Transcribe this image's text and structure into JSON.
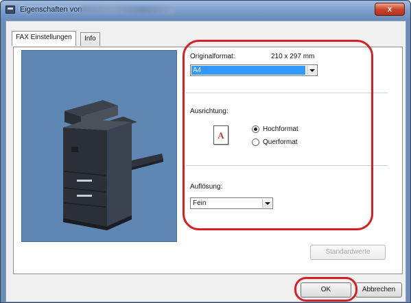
{
  "window": {
    "title": "Eigenschaften von",
    "close_label": "x"
  },
  "tabs": [
    {
      "label": "FAX Einstellungen",
      "active": true
    },
    {
      "label": "Info",
      "active": false
    }
  ],
  "settings": {
    "original_format": {
      "label": "Originalformat:",
      "size_text": "210 x 297 mm",
      "selected": "A4"
    },
    "orientation": {
      "label": "Ausrichtung:",
      "icon_letter": "A",
      "options": [
        {
          "label": "Hochformat",
          "checked": true
        },
        {
          "label": "Querformat",
          "checked": false
        }
      ]
    },
    "resolution": {
      "label": "Auflösung:",
      "selected": "Fein"
    }
  },
  "buttons": {
    "defaults": "Standardwerte",
    "ok": "OK",
    "cancel": "Abbrechen"
  },
  "colors": {
    "annotation_red": "#d61f26",
    "selection_blue": "#3399ff",
    "preview_background": "#5e88b3"
  }
}
